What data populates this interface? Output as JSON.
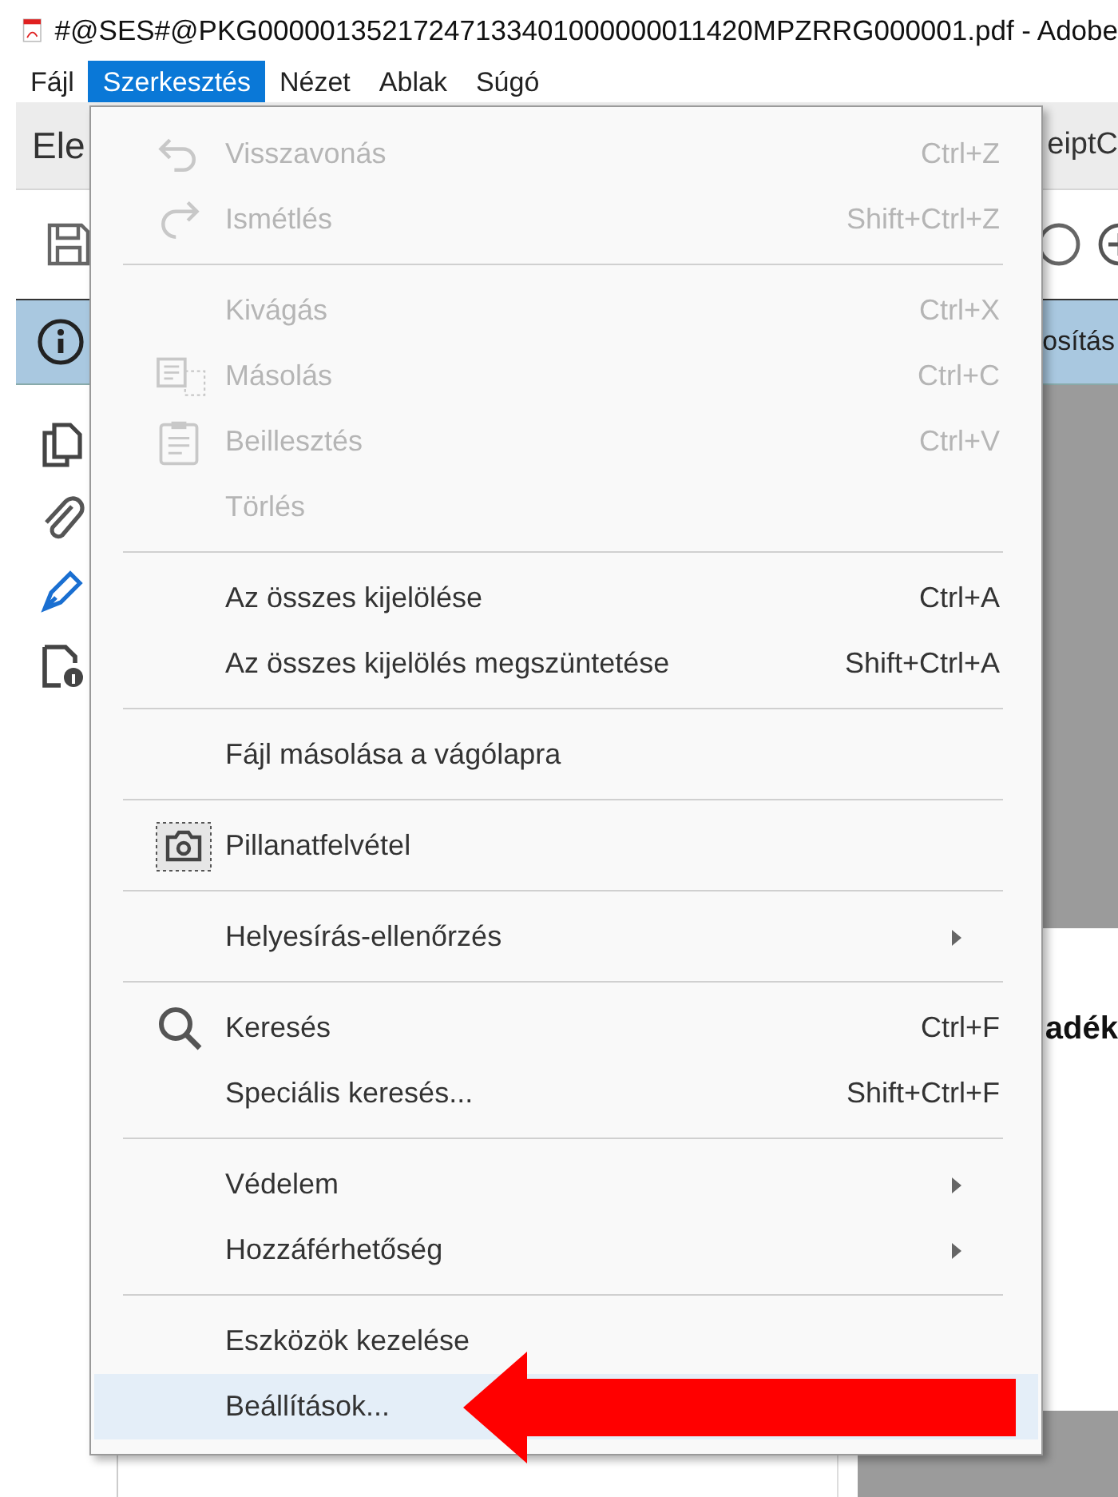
{
  "window": {
    "title": "#@SES#@PKG00000135217247133401000000011420MPZRRG000001.pdf - Adobe"
  },
  "menubar": [
    {
      "label": "Fájl",
      "selected": false
    },
    {
      "label": "Szerkesztés",
      "selected": true
    },
    {
      "label": "Nézet",
      "selected": false
    },
    {
      "label": "Ablak",
      "selected": false
    },
    {
      "label": "Súgó",
      "selected": false
    }
  ],
  "background": {
    "tab_text": "Ele",
    "tab_text_right": "eiptC",
    "banner_text": "osítás",
    "page_text": "adék"
  },
  "menu": {
    "sections": [
      [
        {
          "label": "Visszavonás",
          "shortcut": "Ctrl+Z",
          "disabled": true,
          "submenu": false,
          "selected": false
        },
        {
          "label": "Ismétlés",
          "shortcut": "Shift+Ctrl+Z",
          "disabled": true,
          "submenu": false,
          "selected": false
        }
      ],
      [
        {
          "label": "Kivágás",
          "shortcut": "Ctrl+X",
          "disabled": true,
          "submenu": false,
          "selected": false
        },
        {
          "label": "Másolás",
          "shortcut": "Ctrl+C",
          "disabled": true,
          "submenu": false,
          "selected": false
        },
        {
          "label": "Beillesztés",
          "shortcut": "Ctrl+V",
          "disabled": true,
          "submenu": false,
          "selected": false
        },
        {
          "label": "Törlés",
          "disabled": true,
          "submenu": false,
          "selected": false
        }
      ],
      [
        {
          "label": "Az összes kijelölése",
          "shortcut": "Ctrl+A",
          "disabled": false,
          "submenu": false,
          "selected": false
        },
        {
          "label": "Az összes kijelölés megszüntetése",
          "shortcut": "Shift+Ctrl+A",
          "disabled": false,
          "submenu": false,
          "selected": false
        }
      ],
      [
        {
          "label": "Fájl másolása a vágólapra",
          "disabled": false,
          "submenu": false,
          "selected": false
        }
      ],
      [
        {
          "label": "Pillanatfelvétel",
          "disabled": false,
          "submenu": false,
          "selected": false
        }
      ],
      [
        {
          "label": "Helyesírás-ellenőrzés",
          "disabled": false,
          "submenu": true,
          "selected": false
        }
      ],
      [
        {
          "label": "Keresés",
          "shortcut": "Ctrl+F",
          "disabled": false,
          "submenu": false,
          "selected": false
        },
        {
          "label": "Speciális keresés...",
          "shortcut": "Shift+Ctrl+F",
          "disabled": false,
          "submenu": false,
          "selected": false
        }
      ],
      [
        {
          "label": "Védelem",
          "disabled": false,
          "submenu": true,
          "selected": false
        },
        {
          "label": "Hozzáférhetőség",
          "disabled": false,
          "submenu": true,
          "selected": false
        }
      ],
      [
        {
          "label": "Eszközök kezelése",
          "disabled": false,
          "submenu": false,
          "selected": false
        },
        {
          "label": "Beállítások...",
          "disabled": false,
          "submenu": false,
          "selected": true
        }
      ]
    ]
  }
}
